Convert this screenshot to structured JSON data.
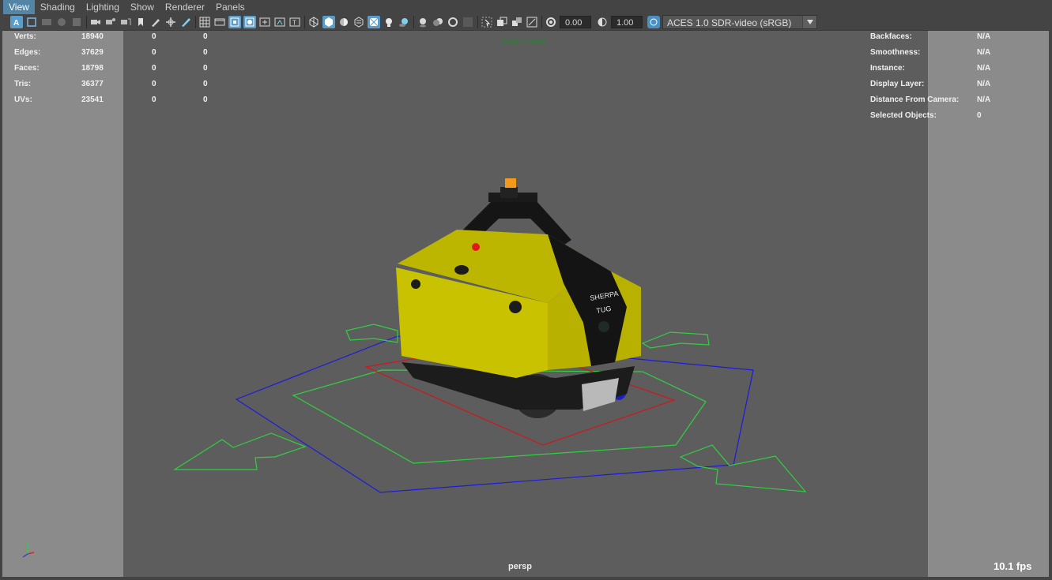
{
  "menu": [
    {
      "label": "View",
      "active": true
    },
    {
      "label": "Shading"
    },
    {
      "label": "Lighting"
    },
    {
      "label": "Show"
    },
    {
      "label": "Renderer"
    },
    {
      "label": "Panels"
    }
  ],
  "toolbar": {
    "exposure_value": "0.00",
    "gamma_value": "1.00",
    "color_management": "ACES 1.0 SDR-video (sRGB)"
  },
  "hud": {
    "left": [
      {
        "label": "Verts:",
        "v1": "18940",
        "v2": "0",
        "v3": "0"
      },
      {
        "label": "Edges:",
        "v1": "37629",
        "v2": "0",
        "v3": "0"
      },
      {
        "label": "Faces:",
        "v1": "18798",
        "v2": "0",
        "v3": "0"
      },
      {
        "label": "Tris:",
        "v1": "36377",
        "v2": "0",
        "v3": "0"
      },
      {
        "label": "UVs:",
        "v1": "23541",
        "v2": "0",
        "v3": "0"
      }
    ],
    "right": [
      {
        "label": "Backfaces:",
        "value": "N/A"
      },
      {
        "label": "Smoothness:",
        "value": "N/A"
      },
      {
        "label": "Instance:",
        "value": "N/A"
      },
      {
        "label": "Display Layer:",
        "value": "N/A"
      },
      {
        "label": "Distance From Camera:",
        "value": "N/A"
      },
      {
        "label": "Selected Objects:",
        "value": "0"
      }
    ],
    "resolution": "2048 x 2048",
    "camera": "persp",
    "fps": "10.1 fps"
  },
  "model": {
    "brand_line1": "SHERPA",
    "brand_line2": "TUG",
    "body_color": "#c9c200",
    "beacon_color": "#f39a1a"
  },
  "colors": {
    "accent": "#5285a6",
    "gate": "#8b8b8b",
    "viewport": "#5d5d5d",
    "manip_green": "#30d040",
    "manip_blue": "#1b1bdc",
    "manip_red": "#d01818"
  }
}
